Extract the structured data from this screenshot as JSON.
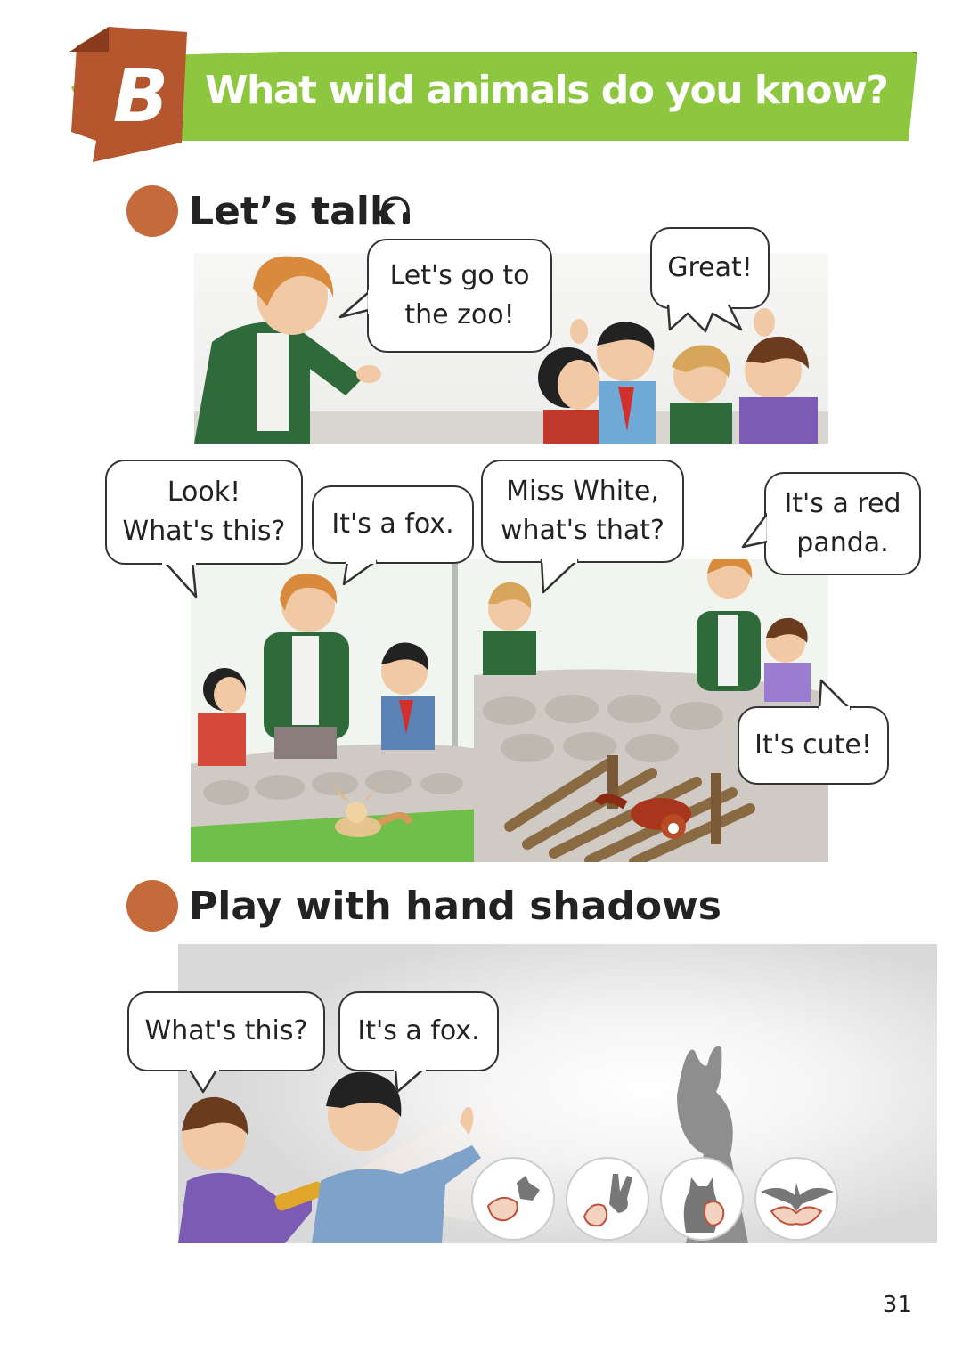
{
  "banner": {
    "letter": "B",
    "title": "What wild animals do you know?",
    "colors": {
      "green": "#8dc63f",
      "dark_green": "#4f8a1e",
      "brown": "#b5562f"
    }
  },
  "sections": {
    "talk": {
      "title": "Let’s talk",
      "icon": "headphones-icon"
    },
    "shadows": {
      "title": "Play with hand shadows"
    }
  },
  "bubbles": {
    "lets_go": "Let's go to\nthe zoo!",
    "great": "Great!",
    "look": "Look!\nWhat's this?",
    "fox": "It's a fox.",
    "miss_white": "Miss White,\nwhat's that?",
    "red_panda": "It's a red\npanda.",
    "cute": "It's cute!",
    "whats_this_2": "What's this?",
    "fox_2": "It's a fox."
  },
  "page_number": "31",
  "colors": {
    "section_dot": "#c46a3b"
  }
}
